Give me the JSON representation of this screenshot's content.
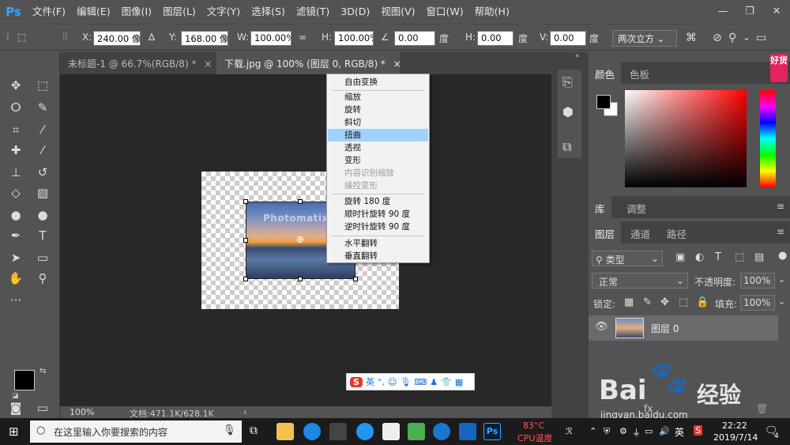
{
  "menubar": {
    "logo": "Ps",
    "items": [
      "文件(F)",
      "编辑(E)",
      "图像(I)",
      "图层(L)",
      "文字(Y)",
      "选择(S)",
      "滤镜(T)",
      "3D(D)",
      "视图(V)",
      "窗口(W)",
      "帮助(H)"
    ]
  },
  "options": {
    "x_label": "X:",
    "x_value": "240.00 像素",
    "y_label": "Y:",
    "y_value": "168.00 像素",
    "w_label": "W:",
    "w_value": "100.00%",
    "h_label": "H:",
    "h_value": "100.00%",
    "angle_value": "0.00",
    "angle_unit": "度",
    "hskew_label": "H:",
    "hskew_value": "0.00",
    "hskew_unit": "度",
    "vskew_label": "V:",
    "vskew_value": "0.00",
    "vskew_unit": "度",
    "interpolation": "两次立方"
  },
  "tabs": [
    {
      "label": "未标题-1 @ 66.7%(RGB/8) *",
      "close": "×"
    },
    {
      "label": "下载.jpg @ 100% (图层 0, RGB/8) *",
      "close": "×"
    }
  ],
  "canvas": {
    "photo_watermark": "Photomatix",
    "accent": "#31a8ff"
  },
  "context_menu": {
    "items": [
      {
        "label": "自由变换",
        "state": "normal"
      },
      {
        "label": "缩放",
        "state": "normal"
      },
      {
        "label": "旋转",
        "state": "normal"
      },
      {
        "label": "斜切",
        "state": "normal"
      },
      {
        "label": "扭曲",
        "state": "highlighted"
      },
      {
        "label": "透视",
        "state": "normal"
      },
      {
        "label": "变形",
        "state": "normal"
      },
      {
        "label": "内容识别缩放",
        "state": "disabled"
      },
      {
        "label": "操控变形",
        "state": "disabled"
      },
      {
        "label": "旋转 180 度",
        "state": "normal"
      },
      {
        "label": "顺时针旋转 90 度",
        "state": "normal"
      },
      {
        "label": "逆时针旋转 90 度",
        "state": "normal"
      },
      {
        "label": "水平翻转",
        "state": "normal"
      },
      {
        "label": "垂直翻转",
        "state": "normal"
      }
    ]
  },
  "ime": {
    "logo": "S",
    "lang": "英"
  },
  "status": {
    "zoom": "100%",
    "doc": "文档:471.1K/628.1K",
    "arrow": "›"
  },
  "panels": {
    "color_tabs": [
      "颜色",
      "色板"
    ],
    "lib_tabs": [
      "库",
      "调整"
    ],
    "layer_tabs": [
      "图层",
      "通道",
      "路径"
    ],
    "filter_kind": "类型",
    "blend_mode": "正常",
    "opacity_label": "不透明度:",
    "opacity_value": "100%",
    "lock_label": "锁定:",
    "fill_label": "填充:",
    "fill_value": "100%",
    "layer_name": "图层 0",
    "fx_label": "fx"
  },
  "ad_badge": "好货",
  "taskbar": {
    "search_placeholder": "在这里输入你要搜索的内容",
    "cpu_temp": "83°C",
    "cpu_label": "CPU温度",
    "ime_lang": "英",
    "time": "22:22",
    "date": "2019/7/14",
    "notif_count": "4"
  },
  "brand_watermark": {
    "main": "Bai",
    "mid": "经验",
    "url": "jingyan.baidu.com"
  }
}
